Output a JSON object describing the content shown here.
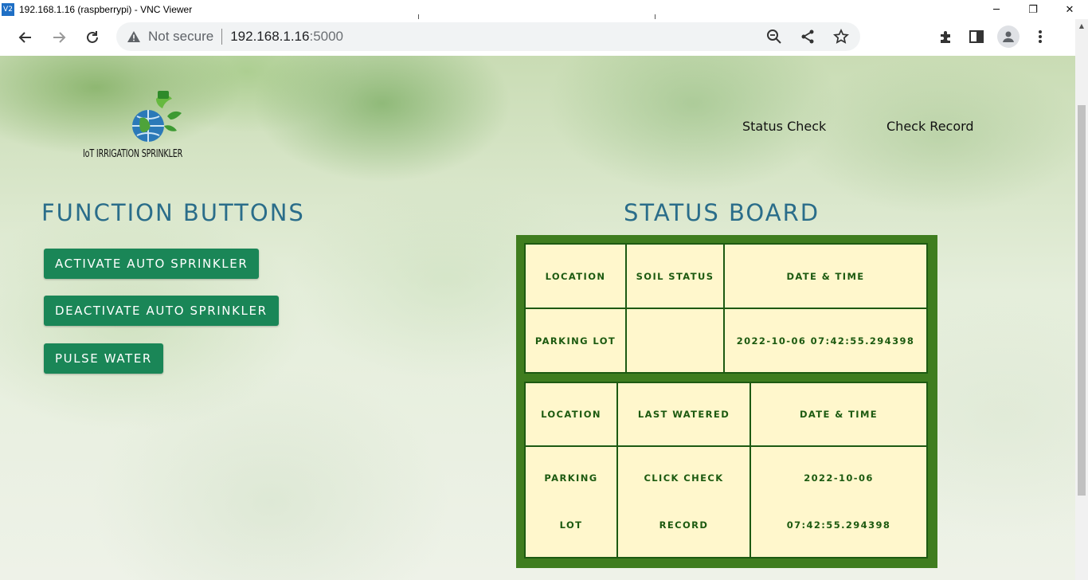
{
  "window": {
    "title": "192.168.1.16 (raspberrypi) - VNC Viewer",
    "icon_label": "V2",
    "minimize": "─",
    "restore": "❐",
    "close": "✕"
  },
  "browser": {
    "back": "←",
    "forward": "→",
    "reload": "↻",
    "security_label": "Not secure",
    "url_host": "192.168.1.16",
    "url_port": ":5000",
    "icons": [
      "zoom-icon",
      "share-icon",
      "star-icon",
      "extensions-icon",
      "side-panel-icon",
      "profile-icon",
      "menu-icon"
    ]
  },
  "header": {
    "logo_text": "IoT IRRIGATION SPRINKLER",
    "nav": [
      "Status Check",
      "Check Record"
    ]
  },
  "functions": {
    "title": "FUNCTION BUTTONS",
    "buttons": [
      "ACTIVATE AUTO SPRINKLER",
      "DEACTIVATE AUTO SPRINKLER",
      "PULSE WATER"
    ]
  },
  "status": {
    "title": "STATUS BOARD",
    "soil_table": {
      "headers": [
        "LOCATION",
        "SOIL STATUS",
        "DATE & TIME"
      ],
      "row": [
        "PARKING LOT",
        "",
        "2022-10-06 07:42:55.294398"
      ]
    },
    "water_table": {
      "headers": [
        "LOCATION",
        "LAST WATERED",
        "DATE & TIME"
      ],
      "row": [
        [
          "PARKING",
          "LOT"
        ],
        [
          "CLICK CHECK",
          "RECORD"
        ],
        [
          "2022-10-06",
          "07:42:55.294398"
        ]
      ]
    }
  },
  "colors": {
    "button_bg": "#1a8657",
    "title_color": "#2a6d8a",
    "board_bg": "#3f7d1f",
    "table_bg": "#fff7cc",
    "table_text": "#1c5a10"
  }
}
